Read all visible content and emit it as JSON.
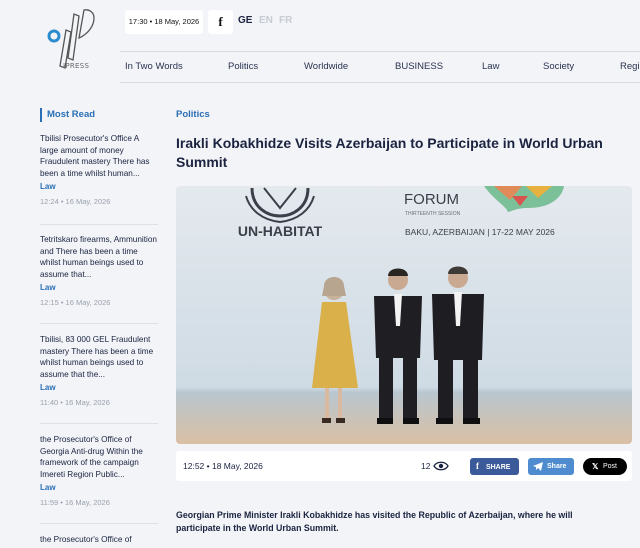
{
  "header": {
    "logo_text": "IPRESS",
    "datetime": "17:30 • 18 May, 2026",
    "facebook_icon": "facebook-icon",
    "languages": [
      {
        "label": "GE",
        "active": true
      },
      {
        "label": "EN",
        "active": false
      },
      {
        "label": "FR",
        "active": false
      }
    ]
  },
  "nav": {
    "items": [
      "In Two Words",
      "Politics",
      "Worldwide",
      "BUSINESS",
      "Law",
      "Society",
      "Regi"
    ]
  },
  "sidebar": {
    "heading": "Most Read",
    "items": [
      {
        "title": "Tbilisi Prosecutor's Office A large amount of money Fraudulent mastery There has been a time whilst human...",
        "category": "Law",
        "time": "12:24 • 16 May, 2026"
      },
      {
        "title": "Tetritskaro firearms, Ammunition and There has been a time whilst human beings used to assume that...",
        "category": "Law",
        "time": "12:15 • 16 May, 2026"
      },
      {
        "title": "Tbilisi, 83 000 GEL Fraudulent mastery There has been a time whilst human beings used to assume that the...",
        "category": "Law",
        "time": "11:40 • 16 May, 2026"
      },
      {
        "title": "the Prosecutor's Office of Georgia Anti-drug Within the framework of the campaign Imereti Region Public...",
        "category": "Law",
        "time": "11:59 • 16 May, 2026"
      },
      {
        "title": "the Prosecutor's Office of",
        "category": "",
        "time": ""
      }
    ]
  },
  "article": {
    "category": "Politics",
    "title": "Irakli Kobakhidze Visits Azerbaijan to Participate in World Urban Summit",
    "photo": {
      "un_habitat": "UN-HABITAT",
      "forum": "FORUM",
      "session": "THIRTEENTH SESSION",
      "location": "BAKU, AZERBAIJAN | 17-22 MAY 2026"
    },
    "time": "12:52 • 18 May, 2026",
    "views": "12",
    "share_facebook": "SHARE",
    "share_telegram": "Share",
    "share_x": "Post",
    "lead": "Georgian Prime Minister Irakli Kobakhidze has visited the Republic of Azerbaijan, where he will participate in the World Urban Summit."
  },
  "colors": {
    "accent": "#2a6fb5",
    "facebook": "#3b5a9a",
    "telegram": "#4e8ccf",
    "x": "#000000"
  }
}
